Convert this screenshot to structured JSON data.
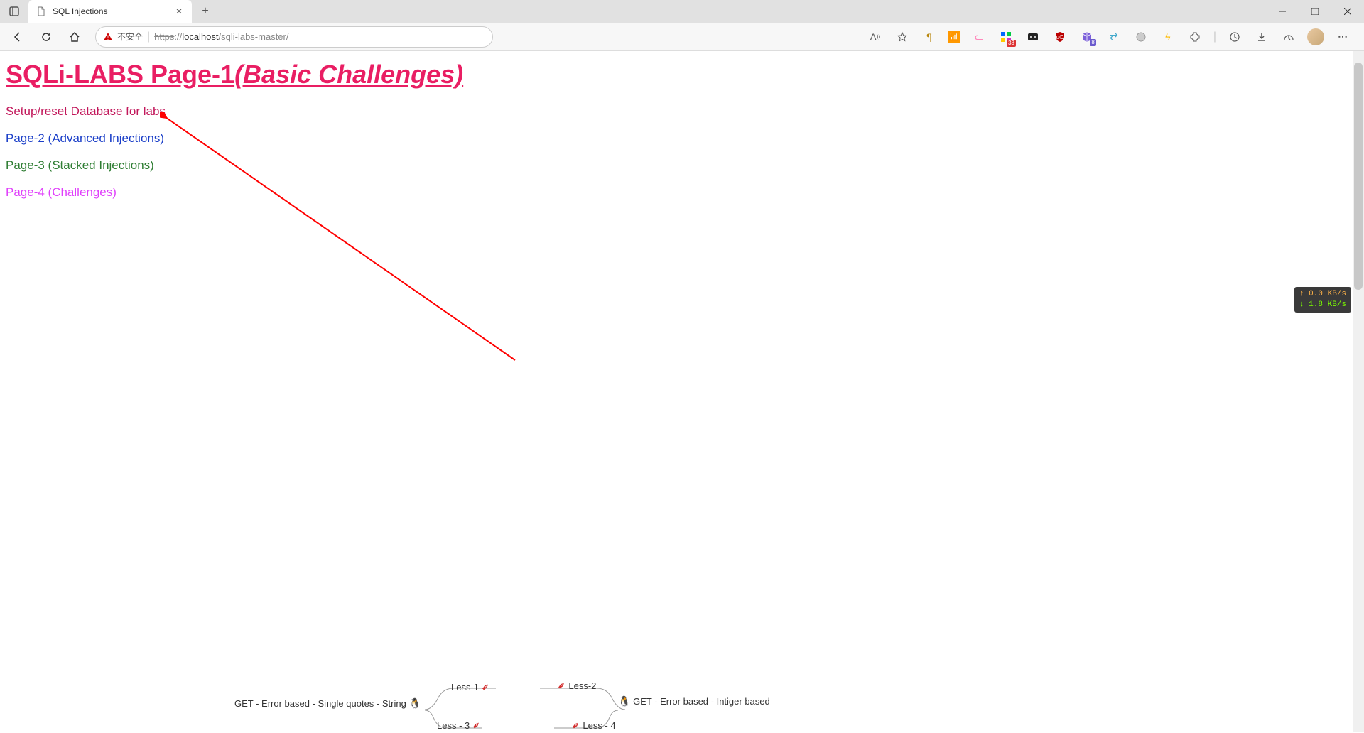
{
  "browser": {
    "tab_title": "SQL Injections",
    "url_prefix": "https",
    "url_sep": "://",
    "url_host": "localhost",
    "url_path": "/sqli-labs-master/",
    "insecure_label": "不安全",
    "ext_badge_1": "33",
    "ext_badge_2": "8"
  },
  "speed": {
    "up": "↑ 0.0 KB/s",
    "down": "↓ 1.8 KB/s"
  },
  "page": {
    "title_part1": "SQLi-LABS Page-1",
    "title_part2": "(Basic Challenges)",
    "links": [
      {
        "label": "Setup/reset Database for labs",
        "cls": "link-red"
      },
      {
        "label": "Page-2 (Advanced Injections)",
        "cls": "link-blue"
      },
      {
        "label": "Page-3 (Stacked Injections)",
        "cls": "link-green"
      },
      {
        "label": "Page-4 (Challenges)",
        "cls": "link-pink"
      }
    ]
  },
  "mindmap": {
    "node1_label": "GET - Error based - Single quotes - String",
    "node1_sub1": "Less-1",
    "node1_sub2": "Less - 3",
    "node2_label": "GET - Error based - Intiger based",
    "node2_sub1": "Less-2",
    "node2_sub2": "Less - 4"
  }
}
